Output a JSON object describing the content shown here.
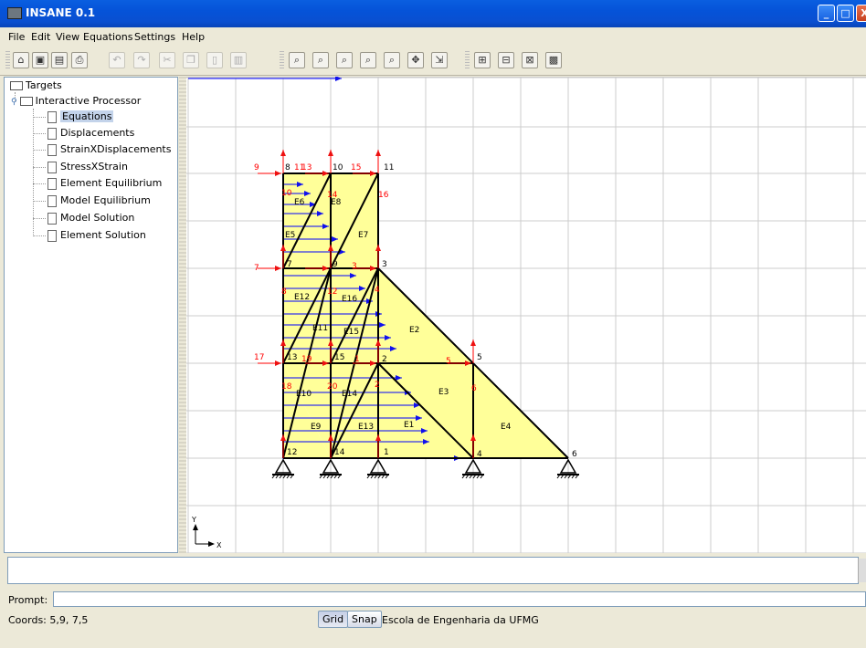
{
  "window": {
    "title": "INSANE 0.1",
    "minimize": "_",
    "maximize": "□",
    "close": "X"
  },
  "menu": [
    "File",
    "Edit",
    "View",
    "Equations",
    "Settings",
    "Help"
  ],
  "tree": {
    "root": "Targets",
    "processor": "Interactive Processor",
    "items": [
      "Equations",
      "Displacements",
      "StrainXDisplacements",
      "StressXStrain",
      "Element Equilibrium",
      "Model Equilibrium",
      "Model Solution",
      "Element Solution"
    ],
    "selected": "Equations"
  },
  "canvas": {
    "nodes": [
      "1",
      "2",
      "3",
      "4",
      "5",
      "6",
      "7",
      "8",
      "9",
      "10",
      "11",
      "12",
      "13",
      "14",
      "15"
    ],
    "elements": [
      "E1",
      "E2",
      "E3",
      "E4",
      "E5",
      "E6",
      "E7",
      "E8",
      "E9",
      "E10",
      "E11",
      "E12",
      "E13",
      "E14",
      "E15",
      "E16"
    ],
    "dof_labels": [
      "1",
      "2",
      "3",
      "4",
      "5",
      "6",
      "7",
      "8",
      "9",
      "10",
      "11",
      "12",
      "13",
      "14",
      "15",
      "16",
      "17",
      "18",
      "19",
      "20"
    ],
    "axis_y": "Y",
    "axis_x": "X"
  },
  "colors": {
    "element_fill": "#ffff99",
    "grid": "#cccccc",
    "dof": "#ff0000",
    "load": "#0000ff"
  },
  "prompt_label": "Prompt:",
  "prompt_value": "",
  "coords": "Coords: 5,9, 7,5",
  "grid_button": "Grid",
  "snap_button": "Snap",
  "organization": "Escola de Engenharia da UFMG"
}
